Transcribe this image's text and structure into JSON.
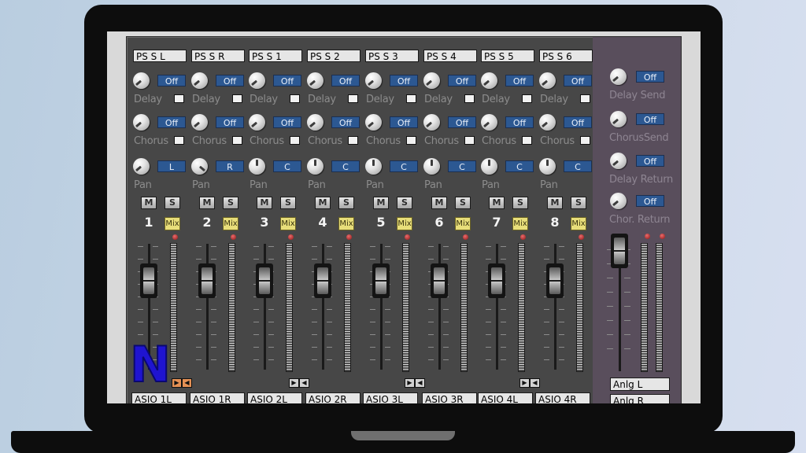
{
  "channels": [
    {
      "name": "PS S L",
      "number": "1",
      "delay": "Off",
      "chorus": "Off",
      "pan": "L",
      "pan_rot": -130,
      "input": "ASIO 1L"
    },
    {
      "name": "PS S R",
      "number": "2",
      "delay": "Off",
      "chorus": "Off",
      "pan": "R",
      "pan_rot": 130,
      "input": "ASIO 1R"
    },
    {
      "name": "PS S 1",
      "number": "3",
      "delay": "Off",
      "chorus": "Off",
      "pan": "C",
      "pan_rot": 0,
      "input": "ASIO 2L"
    },
    {
      "name": "PS S 2",
      "number": "4",
      "delay": "Off",
      "chorus": "Off",
      "pan": "C",
      "pan_rot": 0,
      "input": "ASIO 2R"
    },
    {
      "name": "PS S 3",
      "number": "5",
      "delay": "Off",
      "chorus": "Off",
      "pan": "C",
      "pan_rot": 0,
      "input": "ASIO 3L"
    },
    {
      "name": "PS S 4",
      "number": "6",
      "delay": "Off",
      "chorus": "Off",
      "pan": "C",
      "pan_rot": 0,
      "input": "ASIO 3R"
    },
    {
      "name": "PS S 5",
      "number": "7",
      "delay": "Off",
      "chorus": "Off",
      "pan": "C",
      "pan_rot": 0,
      "input": "ASIO 4L"
    },
    {
      "name": "PS S 6",
      "number": "8",
      "delay": "Off",
      "chorus": "Off",
      "pan": "C",
      "pan_rot": 0,
      "input": "ASIO 4R"
    }
  ],
  "labels": {
    "delay": "Delay",
    "chorus": "Chorus",
    "pan": "Pan",
    "mute": "M",
    "solo": "S",
    "mix": "Mix"
  },
  "master": {
    "delay_send": {
      "label": "Delay Send",
      "value": "Off"
    },
    "chorus_send": {
      "label": "ChorusSend",
      "value": "Off"
    },
    "delay_return": {
      "label": "Delay Return",
      "value": "Off"
    },
    "chorus_return": {
      "label": "Chor. Return",
      "value": "Off"
    },
    "outputs": [
      "Anlg L",
      "Anlg R"
    ]
  },
  "logo_text": "N",
  "colors": {
    "panel": "#474747",
    "master_panel": "#594e5c",
    "value_box": "#2c5892",
    "mix_button": "#e8de7a",
    "link_active": "#e59155",
    "logo": "#1f14d0"
  },
  "arrow_icons": {
    "left": "triangle-left-icon",
    "right": "triangle-right-icon"
  }
}
